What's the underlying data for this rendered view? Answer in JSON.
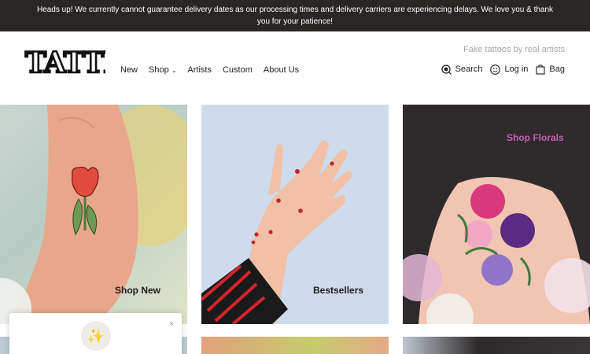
{
  "announcement": "Heads up! We currently cannot guarantee delivery dates as our processing times and delivery carriers are experiencing delays. We love you & thank you for your patience!",
  "brand": {
    "logo_text": "TATTLY",
    "tagline": "Fake tattoos by real artists"
  },
  "nav": [
    "New",
    "Shop",
    "Artists",
    "Custom",
    "About Us"
  ],
  "utility": {
    "search": "Search",
    "login": "Log in",
    "bag": "Bag"
  },
  "tiles": [
    {
      "label": "Shop New"
    },
    {
      "label": "Bestsellers"
    },
    {
      "label": "Shop Florals",
      "color": "#c45fb4"
    }
  ],
  "popup": {
    "icon": "sparkles-icon",
    "close": "×"
  },
  "colors": {
    "announce_bg": "#2b2626",
    "florals_accent": "#c45fb4"
  }
}
